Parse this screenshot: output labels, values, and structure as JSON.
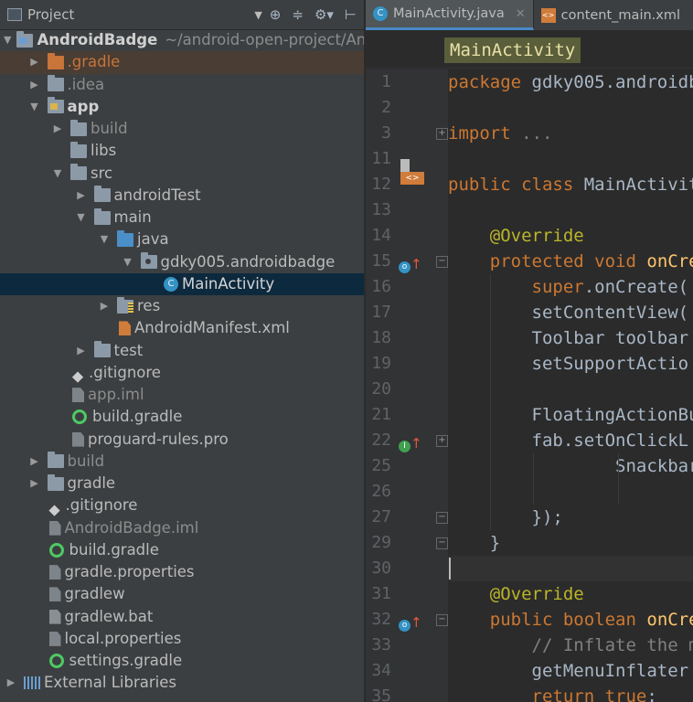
{
  "project_panel": {
    "title": "Project",
    "tree": [
      {
        "label": "AndroidBadge",
        "path": "~/android-open-project/And",
        "arrow": "down",
        "indent": 0,
        "icon": "module-folder",
        "style": "bold"
      },
      {
        "label": ".gradle",
        "arrow": "right",
        "indent": 1,
        "icon": "folder-orange",
        "style": "orange",
        "row": "hl"
      },
      {
        "label": ".idea",
        "arrow": "right",
        "indent": 1,
        "icon": "folder",
        "style": "grey"
      },
      {
        "label": "app",
        "arrow": "down",
        "indent": 1,
        "icon": "app-module-folder",
        "style": "bold"
      },
      {
        "label": "build",
        "arrow": "right",
        "indent": 2,
        "icon": "folder",
        "style": "grey"
      },
      {
        "label": "libs",
        "arrow": "none",
        "indent": 2,
        "icon": "folder",
        "style": ""
      },
      {
        "label": "src",
        "arrow": "down",
        "indent": 2,
        "icon": "folder",
        "style": ""
      },
      {
        "label": "androidTest",
        "arrow": "right",
        "indent": 3,
        "icon": "folder",
        "style": ""
      },
      {
        "label": "main",
        "arrow": "down",
        "indent": 3,
        "icon": "folder",
        "style": ""
      },
      {
        "label": "java",
        "arrow": "down",
        "indent": 4,
        "icon": "folder-blue",
        "style": ""
      },
      {
        "label": "gdky005.androidbadge",
        "arrow": "down",
        "indent": 5,
        "icon": "package-folder",
        "style": ""
      },
      {
        "label": "MainActivity",
        "arrow": "none",
        "indent": 6,
        "icon": "class",
        "style": "active",
        "row": "sel"
      },
      {
        "label": "res",
        "arrow": "right",
        "indent": 4,
        "icon": "res-folder",
        "style": ""
      },
      {
        "label": "AndroidManifest.xml",
        "arrow": "none",
        "indent": 4,
        "icon": "xml-file",
        "style": ""
      },
      {
        "label": "test",
        "arrow": "right",
        "indent": 3,
        "icon": "folder",
        "style": ""
      },
      {
        "label": ".gitignore",
        "arrow": "none",
        "indent": 2,
        "icon": "git",
        "style": ""
      },
      {
        "label": "app.iml",
        "arrow": "none",
        "indent": 2,
        "icon": "file",
        "style": "grey"
      },
      {
        "label": "build.gradle",
        "arrow": "none",
        "indent": 2,
        "icon": "gradle",
        "style": ""
      },
      {
        "label": "proguard-rules.pro",
        "arrow": "none",
        "indent": 2,
        "icon": "file",
        "style": ""
      },
      {
        "label": "build",
        "arrow": "right",
        "indent": 1,
        "icon": "folder",
        "style": "grey"
      },
      {
        "label": "gradle",
        "arrow": "right",
        "indent": 1,
        "icon": "folder",
        "style": ""
      },
      {
        "label": ".gitignore",
        "arrow": "none",
        "indent": 1,
        "icon": "git",
        "style": ""
      },
      {
        "label": "AndroidBadge.iml",
        "arrow": "none",
        "indent": 1,
        "icon": "file",
        "style": "grey"
      },
      {
        "label": "build.gradle",
        "arrow": "none",
        "indent": 1,
        "icon": "gradle",
        "style": ""
      },
      {
        "label": "gradle.properties",
        "arrow": "none",
        "indent": 1,
        "icon": "file",
        "style": ""
      },
      {
        "label": "gradlew",
        "arrow": "none",
        "indent": 1,
        "icon": "file",
        "style": ""
      },
      {
        "label": "gradlew.bat",
        "arrow": "none",
        "indent": 1,
        "icon": "bat-file",
        "style": ""
      },
      {
        "label": "local.properties",
        "arrow": "none",
        "indent": 1,
        "icon": "file",
        "style": ""
      },
      {
        "label": "settings.gradle",
        "arrow": "none",
        "indent": 1,
        "icon": "gradle",
        "style": ""
      },
      {
        "label": "External Libraries",
        "arrow": "right",
        "indent": 0,
        "icon": "libraries",
        "style": ""
      }
    ]
  },
  "editor": {
    "tabs": [
      {
        "label": "MainActivity.java",
        "icon": "class",
        "active": true
      },
      {
        "label": "content_main.xml",
        "icon": "xml-file",
        "active": false
      }
    ],
    "breadcrumb": "MainActivity",
    "lines": [
      {
        "num": "1",
        "html": "<span class=\"kw\">package</span> gdky005.androidb"
      },
      {
        "num": "2",
        "html": ""
      },
      {
        "num": "3",
        "html": "<span class=\"kw\">import</span> <span class=\"fold\">...</span>"
      },
      {
        "num": "11",
        "html": ""
      },
      {
        "num": "12",
        "html": "<span class=\"kw\">public class</span> MainActivit"
      },
      {
        "num": "13",
        "html": ""
      },
      {
        "num": "14",
        "html": "    <span class=\"ann\">@Override</span>"
      },
      {
        "num": "15",
        "html": "    <span class=\"kw\">protected void</span> <span class=\"fn\">onCre</span>"
      },
      {
        "num": "16",
        "html": "        <span class=\"kw\">super</span>.onCreate("
      },
      {
        "num": "17",
        "html": "        setContentView("
      },
      {
        "num": "18",
        "html": "        Toolbar toolbar"
      },
      {
        "num": "19",
        "html": "        setSupportActio"
      },
      {
        "num": "20",
        "html": ""
      },
      {
        "num": "21",
        "html": "        FloatingActionBu"
      },
      {
        "num": "22",
        "html": "        fab.setOnClickL"
      },
      {
        "num": "25",
        "html": "                Snackbar"
      },
      {
        "num": "26",
        "html": ""
      },
      {
        "num": "27",
        "html": "        });"
      },
      {
        "num": "29",
        "html": "    }"
      },
      {
        "num": "30",
        "html": ""
      },
      {
        "num": "31",
        "html": "    <span class=\"ann\">@Override</span>"
      },
      {
        "num": "32",
        "html": "    <span class=\"kw\">public boolean</span> <span class=\"fn\">onCre</span>"
      },
      {
        "num": "33",
        "html": "        <span class=\"cmt\">// Inflate the m</span>"
      },
      {
        "num": "34",
        "html": "        getMenuInflater"
      },
      {
        "num": "35",
        "html": "        <span class=\"kw\">return true</span>;"
      }
    ]
  },
  "colors": {
    "panel_bg": "#3c3f41",
    "editor_bg": "#2b2b2b",
    "selection": "#0d293e",
    "keyword": "#cc7832",
    "annotation": "#bbb529",
    "method": "#ffc66d"
  }
}
